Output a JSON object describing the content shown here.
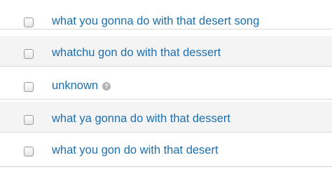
{
  "items": [
    {
      "label": "what you gonna do with that desert song"
    },
    {
      "label": "whatchu gon do with that dessert"
    },
    {
      "label": "unknown",
      "icon": "help-icon",
      "icon_glyph": "?"
    },
    {
      "label": "what ya gonna do with that dessert"
    },
    {
      "label": "what you gon do with that desert"
    }
  ],
  "colors": {
    "link": "#1c6fb0",
    "row_alt_bg": "#f4f4f4",
    "divider": "#d8d8d8"
  }
}
